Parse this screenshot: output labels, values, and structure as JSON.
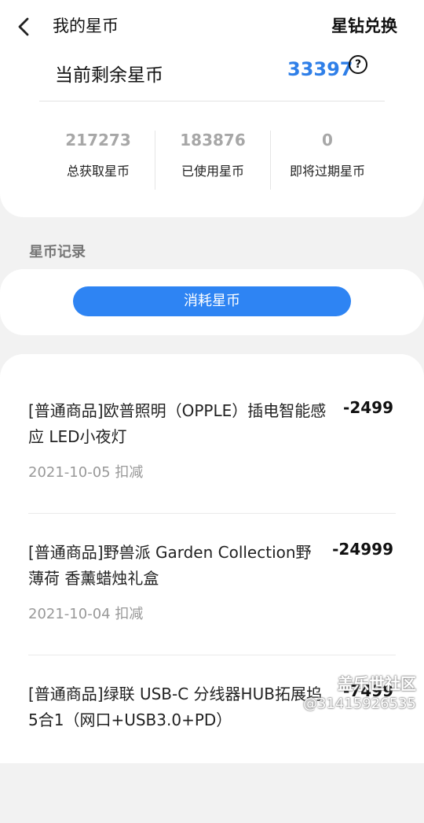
{
  "header": {
    "title": "我的星币",
    "exchange_label": "星钻兑换",
    "back_icon": "chevron-left-icon"
  },
  "summary": {
    "balance_label": "当前剩余星币",
    "balance_value": "33397",
    "help_icon": "question-circle-icon",
    "stats": [
      {
        "value": "217273",
        "label": "总获取星币"
      },
      {
        "value": "183876",
        "label": "已使用星币"
      },
      {
        "value": "0",
        "label": "即将过期星币"
      }
    ]
  },
  "section_title": "星币记录",
  "tab": {
    "label": "消耗星币"
  },
  "records": [
    {
      "name": "[普通商品]欧普照明（OPPLE）插电智能感应 LED小夜灯",
      "amount": "-2499",
      "date": "2021-10-05 扣减"
    },
    {
      "name": "[普通商品]野兽派 Garden Collection野薄荷 香薰蜡烛礼盒",
      "amount": "-24999",
      "date": "2021-10-04 扣减"
    },
    {
      "name": "[普通商品]绿联 USB-C 分线器HUB拓展坞 5合1（网口+USB3.0+PD）",
      "amount": "-7499",
      "date": ""
    }
  ],
  "watermark": {
    "line1": "盖乐世社区",
    "line2": "@31415926535"
  },
  "colors": {
    "accent": "#2e84f3",
    "balance": "#2f7fe8"
  }
}
